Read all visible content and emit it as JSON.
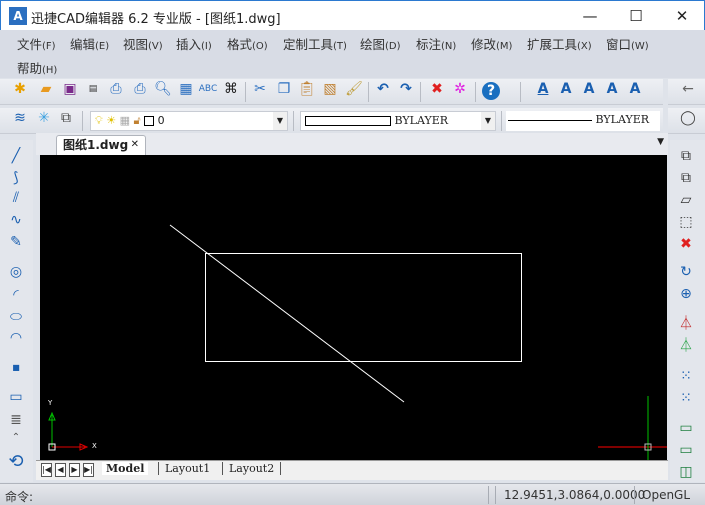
{
  "window": {
    "title": "迅捷CAD编辑器 6.2 专业版  - [图纸1.dwg]",
    "app_icon_text": "A",
    "minimize": "—",
    "maximize": "☐",
    "close": "✕"
  },
  "menu": [
    {
      "label": "文件",
      "key": "(F)"
    },
    {
      "label": "编辑",
      "key": "(E)"
    },
    {
      "label": "视图",
      "key": "(V)"
    },
    {
      "label": "插入",
      "key": "(I)"
    },
    {
      "label": "格式",
      "key": "(O)"
    },
    {
      "label": "定制工具",
      "key": "(T)"
    },
    {
      "label": "绘图",
      "key": "(D)"
    },
    {
      "label": "标注",
      "key": "(N)"
    },
    {
      "label": "修改",
      "key": "(M)"
    },
    {
      "label": "扩展工具",
      "key": "(X)"
    },
    {
      "label": "窗口",
      "key": "(W)"
    },
    {
      "label": "帮助",
      "key": "(H)"
    }
  ],
  "layer": {
    "current": "0"
  },
  "linetype": {
    "value": "BYLAYER"
  },
  "lineweight": {
    "value": "BYLAYER"
  },
  "document_tab": {
    "label": "图纸1.dwg",
    "close": "✕"
  },
  "layout_tabs": [
    "Model",
    "Layout1",
    "Layout2"
  ],
  "ucs": {
    "x": "X",
    "y": "Y"
  },
  "status": {
    "command_label": "命令:",
    "coordinates": "12.9451,3.0864,0.0000",
    "renderer": "OpenGL"
  },
  "colors": {
    "accent": "#2b6fc0",
    "canvas": "#000000",
    "crosshair_x": "#ff0000",
    "crosshair_y": "#00c000"
  }
}
